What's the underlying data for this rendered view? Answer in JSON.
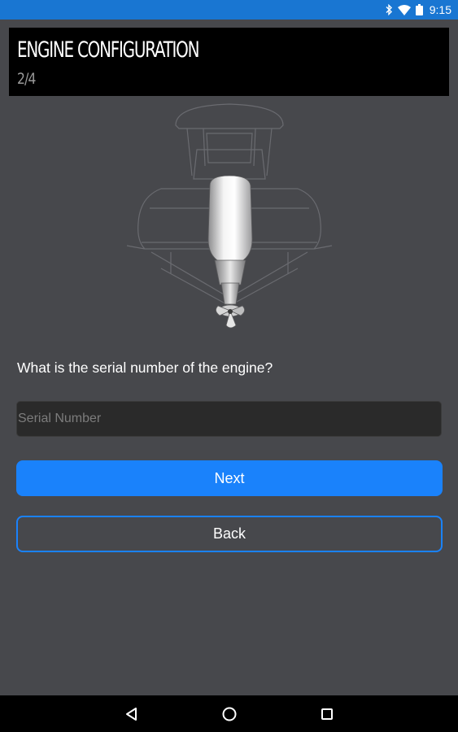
{
  "status_bar": {
    "time": "9:15",
    "background_color": "#1976d2",
    "icons": [
      "bluetooth-icon",
      "wifi-icon",
      "battery-icon"
    ]
  },
  "header": {
    "title": "ENGINE CONFIGURATION",
    "step": "2/4"
  },
  "illustration": {
    "icons": [
      "boat-outline-icon",
      "outboard-engine-icon"
    ]
  },
  "form": {
    "question": "What is the serial number of the engine?",
    "serial_placeholder": "Serial Number",
    "serial_value": ""
  },
  "buttons": {
    "next_label": "Next",
    "back_label": "Back",
    "accent_color": "#1a82fb"
  },
  "nav_bar": {
    "icons": [
      "nav-back-icon",
      "nav-home-icon",
      "nav-recents-icon"
    ]
  }
}
